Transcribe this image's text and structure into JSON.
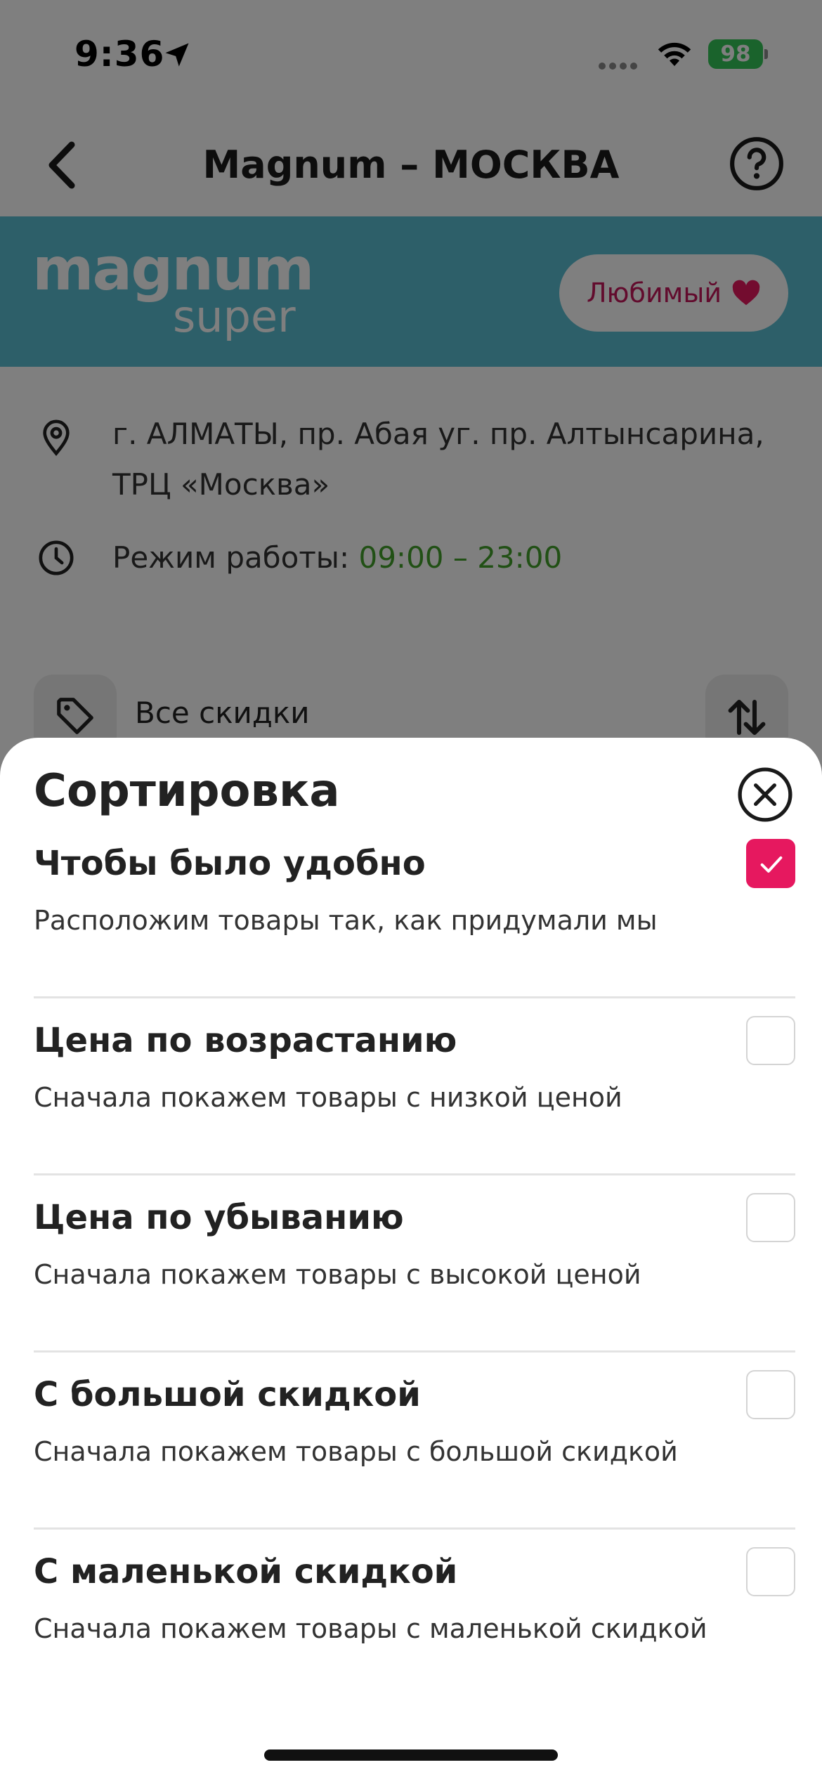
{
  "status_bar": {
    "time": "9:36",
    "battery": "98",
    "icons": [
      "location-arrow-icon",
      "cellular-signal-icon",
      "wifi-icon",
      "battery-icon"
    ]
  },
  "nav": {
    "title": "Magnum – МОСКВА",
    "back_icon": "chevron-left-icon",
    "help_icon": "question-circle-icon"
  },
  "store": {
    "brand_main": "magnum",
    "brand_sub": "super",
    "banner_color": "#5bbfd3",
    "favorite_label": "Любимый",
    "address_line1": "г. АЛМАТЫ, пр. Абая уг. пр. Алтынсарина,",
    "address_line2": "ТРЦ «Москва»",
    "hours_label": "Режим работы: ",
    "hours_value": "09:00 – 23:00"
  },
  "filter": {
    "label": "Все скидки",
    "tag_icon": "tag-icon",
    "sort_icon": "sort-arrows-icon"
  },
  "sort_sheet": {
    "title": "Сортировка",
    "accent_color": "#e6185f",
    "options": [
      {
        "title": "Чтобы было удобно",
        "description": "Расположим товары так, как придумали мы",
        "checked": true
      },
      {
        "title": "Цена по возрастанию",
        "description": "Сначала покажем товары с низкой ценой",
        "checked": false
      },
      {
        "title": "Цена по убыванию",
        "description": "Сначала покажем товары с высокой ценой",
        "checked": false
      },
      {
        "title": "С большой скидкой",
        "description": "Сначала покажем товары с большой скидкой",
        "checked": false
      },
      {
        "title": "С маленькой скидкой",
        "description": "Сначала покажем товары с маленькой скидкой",
        "checked": false
      }
    ]
  }
}
